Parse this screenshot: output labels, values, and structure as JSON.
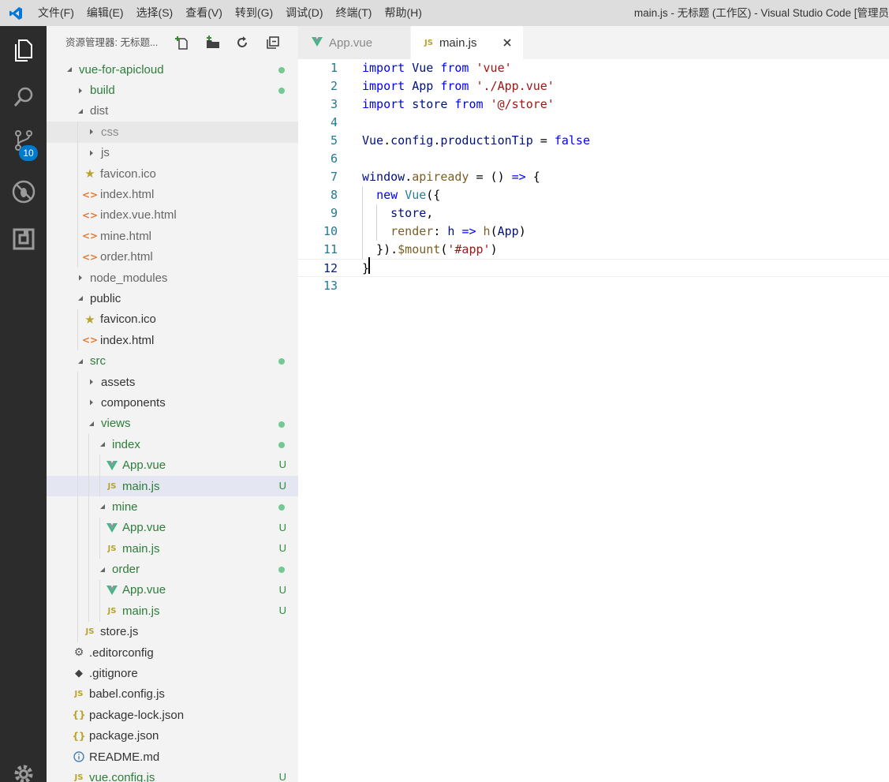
{
  "titlebar": {
    "menus": [
      "文件(F)",
      "编辑(E)",
      "选择(S)",
      "查看(V)",
      "转到(G)",
      "调试(D)",
      "终端(T)",
      "帮助(H)"
    ],
    "window_title": "main.js - 无标题 (工作区) - Visual Studio Code [管理员"
  },
  "activitybar": {
    "items": [
      "explorer-icon",
      "search-icon",
      "source-control-icon",
      "debug-icon",
      "extensions-icon",
      "settings-gear-icon"
    ],
    "scm_badge": "10"
  },
  "sidebar": {
    "title": "资源管理器: 无标题...",
    "actions": [
      "new-file-icon",
      "new-folder-icon",
      "refresh-icon",
      "collapse-all-icon"
    ],
    "tree": [
      {
        "name": "vue-for-apicloud",
        "kind": "root",
        "depth": 0,
        "expanded": true,
        "color": "green",
        "dot": true
      },
      {
        "name": "build",
        "kind": "folder",
        "depth": 1,
        "expanded": false,
        "color": "green",
        "dot": true
      },
      {
        "name": "dist",
        "kind": "folder",
        "depth": 1,
        "expanded": true,
        "color": "gray"
      },
      {
        "name": "css",
        "kind": "folder",
        "depth": 2,
        "expanded": false,
        "color": "light",
        "hover": true
      },
      {
        "name": "js",
        "kind": "folder",
        "depth": 2,
        "expanded": false,
        "color": "gray"
      },
      {
        "name": "favicon.ico",
        "kind": "ico",
        "depth": 2,
        "color": "gray"
      },
      {
        "name": "index.html",
        "kind": "html",
        "depth": 2,
        "color": "gray"
      },
      {
        "name": "index.vue.html",
        "kind": "html",
        "depth": 2,
        "color": "gray"
      },
      {
        "name": "mine.html",
        "kind": "html",
        "depth": 2,
        "color": "gray"
      },
      {
        "name": "order.html",
        "kind": "html",
        "depth": 2,
        "color": "gray"
      },
      {
        "name": "node_modules",
        "kind": "folder",
        "depth": 1,
        "expanded": false,
        "color": "gray"
      },
      {
        "name": "public",
        "kind": "folder",
        "depth": 1,
        "expanded": true,
        "color": "normal"
      },
      {
        "name": "favicon.ico",
        "kind": "ico",
        "depth": 2,
        "color": "normal"
      },
      {
        "name": "index.html",
        "kind": "html",
        "depth": 2,
        "color": "normal"
      },
      {
        "name": "src",
        "kind": "folder",
        "depth": 1,
        "expanded": true,
        "color": "green",
        "dot": true
      },
      {
        "name": "assets",
        "kind": "folder",
        "depth": 2,
        "expanded": false,
        "color": "normal"
      },
      {
        "name": "components",
        "kind": "folder",
        "depth": 2,
        "expanded": false,
        "color": "normal"
      },
      {
        "name": "views",
        "kind": "folder",
        "depth": 2,
        "expanded": true,
        "color": "green",
        "dot": true
      },
      {
        "name": "index",
        "kind": "folder",
        "depth": 3,
        "expanded": true,
        "color": "green",
        "dot": true
      },
      {
        "name": "App.vue",
        "kind": "vue",
        "depth": 4,
        "color": "green",
        "status": "U"
      },
      {
        "name": "main.js",
        "kind": "js",
        "depth": 4,
        "color": "green",
        "status": "U",
        "selected": true
      },
      {
        "name": "mine",
        "kind": "folder",
        "depth": 3,
        "expanded": true,
        "color": "green",
        "dot": true
      },
      {
        "name": "App.vue",
        "kind": "vue",
        "depth": 4,
        "color": "green",
        "status": "U"
      },
      {
        "name": "main.js",
        "kind": "js",
        "depth": 4,
        "color": "green",
        "status": "U"
      },
      {
        "name": "order",
        "kind": "folder",
        "depth": 3,
        "expanded": true,
        "color": "green",
        "dot": true
      },
      {
        "name": "App.vue",
        "kind": "vue",
        "depth": 4,
        "color": "green",
        "status": "U"
      },
      {
        "name": "main.js",
        "kind": "js",
        "depth": 4,
        "color": "green",
        "status": "U"
      },
      {
        "name": "store.js",
        "kind": "js",
        "depth": 2,
        "color": "normal"
      },
      {
        "name": ".editorconfig",
        "kind": "config",
        "depth": 1,
        "color": "normal"
      },
      {
        "name": ".gitignore",
        "kind": "git",
        "depth": 1,
        "color": "normal"
      },
      {
        "name": "babel.config.js",
        "kind": "js",
        "depth": 1,
        "color": "normal"
      },
      {
        "name": "package-lock.json",
        "kind": "json",
        "depth": 1,
        "color": "normal"
      },
      {
        "name": "package.json",
        "kind": "json",
        "depth": 1,
        "color": "normal"
      },
      {
        "name": "README.md",
        "kind": "info",
        "depth": 1,
        "color": "normal"
      },
      {
        "name": "vue.config.js",
        "kind": "js",
        "depth": 1,
        "color": "green",
        "status": "U"
      }
    ]
  },
  "tabs": [
    {
      "label": "App.vue",
      "icon": "vue-file-icon",
      "active": false
    },
    {
      "label": "main.js",
      "icon": "js-file-icon",
      "active": true
    }
  ],
  "editor": {
    "cursor_line": 12,
    "lines": [
      [
        [
          "kw",
          "import"
        ],
        [
          "plain",
          " "
        ],
        [
          "ident",
          "Vue"
        ],
        [
          "plain",
          " "
        ],
        [
          "kw",
          "from"
        ],
        [
          "plain",
          " "
        ],
        [
          "str",
          "'vue'"
        ]
      ],
      [
        [
          "kw",
          "import"
        ],
        [
          "plain",
          " "
        ],
        [
          "ident",
          "App"
        ],
        [
          "plain",
          " "
        ],
        [
          "kw",
          "from"
        ],
        [
          "plain",
          " "
        ],
        [
          "str",
          "'./App.vue'"
        ]
      ],
      [
        [
          "kw",
          "import"
        ],
        [
          "plain",
          " "
        ],
        [
          "ident",
          "store"
        ],
        [
          "plain",
          " "
        ],
        [
          "kw",
          "from"
        ],
        [
          "plain",
          " "
        ],
        [
          "str",
          "'@/store'"
        ]
      ],
      [],
      [
        [
          "ident",
          "Vue"
        ],
        [
          "plain",
          "."
        ],
        [
          "ident",
          "config"
        ],
        [
          "plain",
          "."
        ],
        [
          "ident",
          "productionTip"
        ],
        [
          "plain",
          " = "
        ],
        [
          "kw",
          "false"
        ]
      ],
      [],
      [
        [
          "ident",
          "window"
        ],
        [
          "plain",
          "."
        ],
        [
          "fn",
          "apiready"
        ],
        [
          "plain",
          " = () "
        ],
        [
          "kw",
          "=>"
        ],
        [
          "plain",
          " {"
        ]
      ],
      [
        [
          "plain",
          "  "
        ],
        [
          "kw",
          "new"
        ],
        [
          "plain",
          " "
        ],
        [
          "cls",
          "Vue"
        ],
        [
          "plain",
          "({"
        ]
      ],
      [
        [
          "plain",
          "    "
        ],
        [
          "ident",
          "store"
        ],
        [
          "plain",
          ","
        ]
      ],
      [
        [
          "plain",
          "    "
        ],
        [
          "fn",
          "render"
        ],
        [
          "plain",
          ": "
        ],
        [
          "ident",
          "h"
        ],
        [
          "plain",
          " "
        ],
        [
          "kw",
          "=>"
        ],
        [
          "plain",
          " "
        ],
        [
          "fn",
          "h"
        ],
        [
          "plain",
          "("
        ],
        [
          "ident",
          "App"
        ],
        [
          "plain",
          ")"
        ]
      ],
      [
        [
          "plain",
          "  })."
        ],
        [
          "fn",
          "$mount"
        ],
        [
          "plain",
          "("
        ],
        [
          "str",
          "'#app'"
        ],
        [
          "plain",
          ")"
        ]
      ],
      [
        [
          "plain",
          "}"
        ]
      ],
      []
    ]
  }
}
